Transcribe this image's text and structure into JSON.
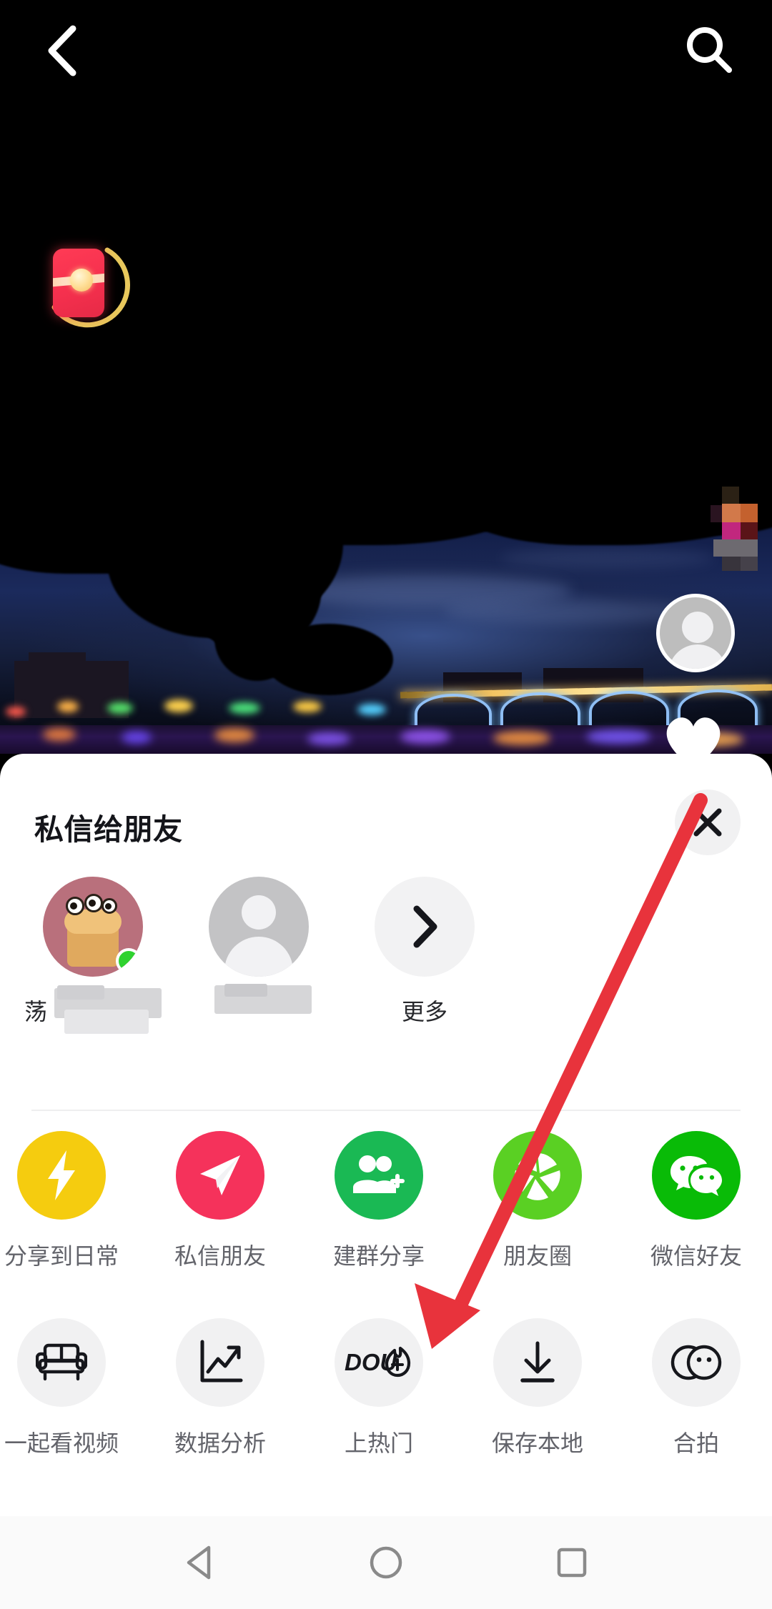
{
  "topbar": {
    "back_icon": "chevron-left-icon",
    "search_icon": "search-icon"
  },
  "video": {
    "redpacket_icon": "red-packet-icon",
    "author_avatar": "avatar",
    "like_icon": "heart-icon",
    "watermark": "blurred-watermark"
  },
  "sheet": {
    "title": "私信给朋友",
    "close_icon": "close-icon",
    "friends": [
      {
        "name": "荡",
        "avatar": "friend-avatar-cartoon",
        "online": true,
        "censored": true
      },
      {
        "name": "",
        "avatar": "friend-avatar-default",
        "online": false,
        "censored": true
      }
    ],
    "more_label": "更多",
    "more_icon": "chevron-right-icon",
    "apps_row1": [
      {
        "label": "分享到日常",
        "icon": "lightning-icon",
        "color": "#f5cc0f"
      },
      {
        "label": "私信朋友",
        "icon": "paper-plane-icon",
        "color": "#f5325b"
      },
      {
        "label": "建群分享",
        "icon": "group-add-icon",
        "color": "#1ab954"
      },
      {
        "label": "朋友圈",
        "icon": "moments-shutter-icon",
        "color": "#5ad023"
      },
      {
        "label": "微信好友",
        "icon": "wechat-icon",
        "color": "#09bb07"
      }
    ],
    "apps_row2": [
      {
        "label": "一起看视频",
        "icon": "sofa-icon",
        "color": "#f1f1f2"
      },
      {
        "label": "数据分析",
        "icon": "chart-trend-icon",
        "color": "#f1f1f2"
      },
      {
        "label": "上热门",
        "icon": "dou-plus-icon",
        "color": "#f1f1f2"
      },
      {
        "label": "保存本地",
        "icon": "download-icon",
        "color": "#f1f1f2"
      },
      {
        "label": "合拍",
        "icon": "duet-circles-icon",
        "color": "#f1f1f2"
      }
    ]
  },
  "annotation": {
    "arrow_color": "#e8333c",
    "points_to": "上热门"
  },
  "navbar": {
    "back_icon": "triangle-back-icon",
    "home_icon": "circle-home-icon",
    "recents_icon": "square-recents-icon"
  }
}
